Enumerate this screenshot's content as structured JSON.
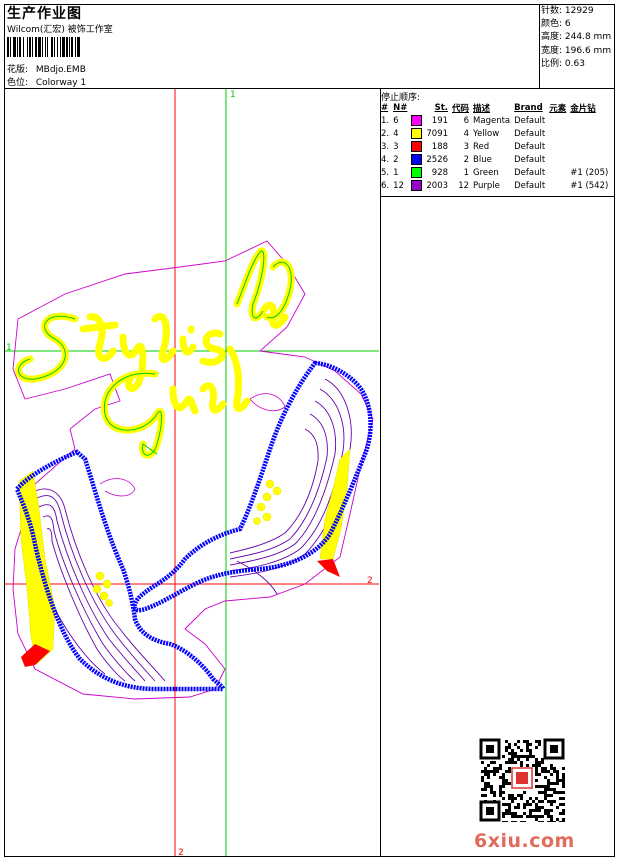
{
  "header": {
    "title": "生产作业图",
    "subtitle": "Wilcom(汇宏) 被饰工作室",
    "design_file_label": "花版:",
    "design_file": "MBdjo.EMB",
    "colorway_label": "色位:",
    "colorway": "Colorway 1"
  },
  "stats": [
    {
      "label": "针数:",
      "value": "12929"
    },
    {
      "label": "颜色:",
      "value": "6"
    },
    {
      "label": "高度:",
      "value": "244.8 mm"
    },
    {
      "label": "宽度:",
      "value": "196.6 mm"
    },
    {
      "label": "比例:",
      "value": "0.63"
    }
  ],
  "stop_sequence": {
    "title": "停止顺序:",
    "headers": [
      "#",
      "N#",
      "St.",
      "代码",
      "描述",
      "Brand",
      "元素",
      "金片钻"
    ],
    "rows": [
      {
        "index": "1.",
        "n": "6",
        "color": "#ff00ff",
        "st": "191",
        "code": "6",
        "desc": "Magenta",
        "brand": "Default",
        "element": "",
        "sequin": ""
      },
      {
        "index": "2.",
        "n": "4",
        "color": "#ffff00",
        "st": "7091",
        "code": "4",
        "desc": "Yellow",
        "brand": "Default",
        "element": "",
        "sequin": ""
      },
      {
        "index": "3.",
        "n": "3",
        "color": "#ff0000",
        "st": "188",
        "code": "3",
        "desc": "Red",
        "brand": "Default",
        "element": "",
        "sequin": ""
      },
      {
        "index": "4.",
        "n": "2",
        "color": "#0000ff",
        "st": "2526",
        "code": "2",
        "desc": "Blue",
        "brand": "Default",
        "element": "",
        "sequin": ""
      },
      {
        "index": "5.",
        "n": "1",
        "color": "#00ff00",
        "st": "928",
        "code": "1",
        "desc": "Green",
        "brand": "Default",
        "element": "",
        "sequin": "#1 (205)"
      },
      {
        "index": "6.",
        "n": "12",
        "color": "#9900cc",
        "st": "2003",
        "code": "12",
        "desc": "Purple",
        "brand": "Default",
        "element": "",
        "sequin": "#1 (542)"
      }
    ]
  },
  "design": {
    "guide_labels": {
      "green_v": "1",
      "green_h": "1",
      "red_h": "2",
      "red_v": "2"
    },
    "colors": {
      "magenta": "#cc00cc",
      "yellow": "#ffff00",
      "red": "#ff0000",
      "blue": "#0000ff",
      "green": "#00cc00",
      "purple": "#6600aa",
      "guide_red": "#ff0000",
      "guide_green": "#00cc00"
    }
  },
  "watermark": {
    "site": "6xiu.com"
  }
}
